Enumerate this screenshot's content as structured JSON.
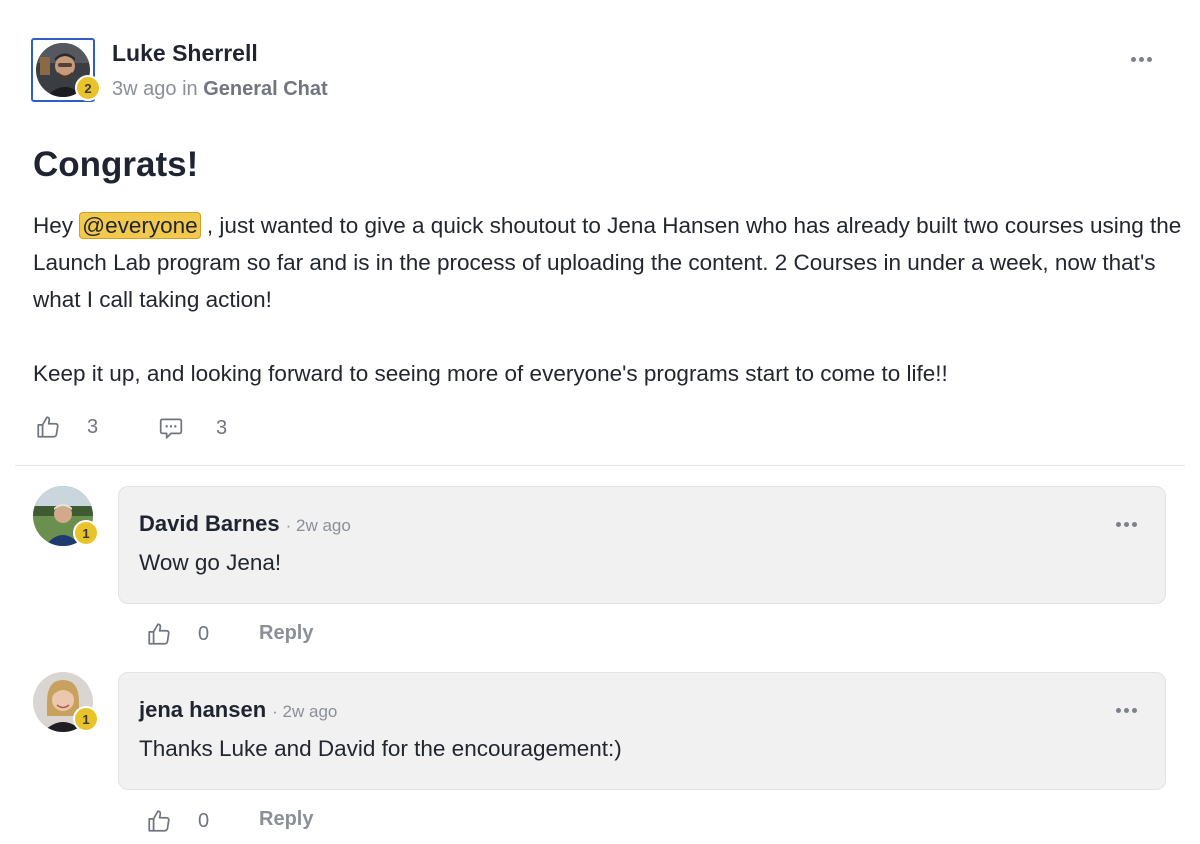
{
  "post": {
    "author": "Luke Sherrell",
    "author_level": "2",
    "time": "3w ago",
    "in_label": "in",
    "channel": "General Chat",
    "title": "Congrats!",
    "body": {
      "p1_prefix": "Hey ",
      "mention": "@everyone",
      "p1_rest": " , just wanted to give a quick shoutout to Jena Hansen who has already built two courses using the Launch Lab program so far and is in the process of uploading the content. 2 Courses in under a week, now that's what I call taking action!",
      "p2": "Keep it up, and looking forward to seeing more of everyone's programs start to come to life!!"
    },
    "like_count": "3",
    "comment_count": "3",
    "more_icon": "more-dots-icon"
  },
  "comments": [
    {
      "author": "David Barnes",
      "level": "1",
      "time": "· 2w ago",
      "text": "Wow go Jena!",
      "like_count": "0",
      "reply_label": "Reply"
    },
    {
      "author": "jena hansen",
      "level": "1",
      "time": "· 2w ago",
      "text": "Thanks Luke and David for the encouragement:)",
      "like_count": "0",
      "reply_label": "Reply"
    }
  ],
  "colors": {
    "mention_bg": "#f2c94c",
    "level_badge": "#e9c32a",
    "avatar_frame": "#2f5fc4",
    "bubble_bg": "#f1f1f2"
  }
}
